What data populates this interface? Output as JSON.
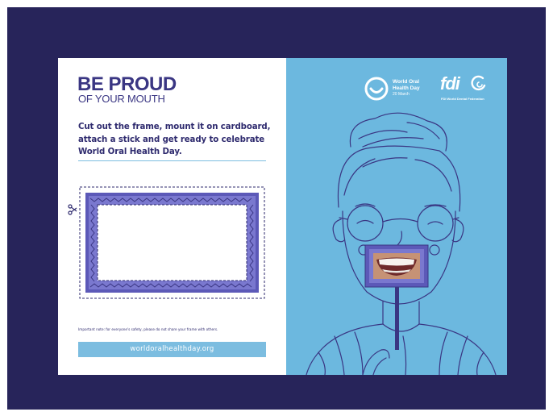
{
  "colors": {
    "background": "#27245a",
    "brand_navy": "#3a3683",
    "sky_blue": "#6cb8df",
    "light_blue": "#7cbde0",
    "frame_purple": "#5c59b8"
  },
  "left_panel": {
    "title_line1": "BE PROUD",
    "title_line2": "OF YOUR MOUTH",
    "instructions": "Cut out the frame, mount it on cardboard, attach a stick and get ready to celebrate World Oral Health Day.",
    "notice": "Important note: for everyone's safety, please do not share your frame with others.",
    "url": "worldoralhealthday.org"
  },
  "right_panel": {
    "event_line1": "World Oral",
    "event_line2": "Health Day",
    "event_date": "20 March",
    "org_wordmark": "fdi",
    "org_name": "FDI World Dental Federation"
  },
  "icons": {
    "scissors": "scissors-icon",
    "event_logo": "smile-circle-icon",
    "org_logo": "fdi-mark-icon"
  }
}
